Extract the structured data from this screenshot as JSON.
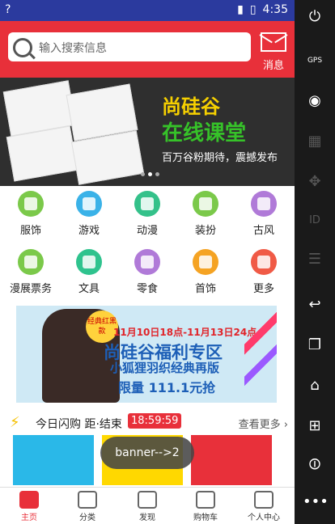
{
  "status": {
    "time": "4:35",
    "left": "?"
  },
  "search": {
    "placeholder": "输入搜索信息"
  },
  "header": {
    "msg_label": "消息"
  },
  "banner": {
    "brand": "尚硅谷",
    "title": "在线课堂",
    "subtitle": "百万谷粉期待，震撼发布"
  },
  "categories": [
    "服饰",
    "游戏",
    "动漫",
    "装扮",
    "古风",
    "漫展票务",
    "文具",
    "零食",
    "首饰",
    "更多"
  ],
  "category_colors": [
    "#7bc94a",
    "#3ab2e8",
    "#34c18a",
    "#7bc94a",
    "#b07ad8",
    "#7bc94a",
    "#2fc38e",
    "#b07ad8",
    "#f5a323",
    "#f05a46"
  ],
  "promo": {
    "badge": "经典红黑款",
    "line1": "11月10日18点-11月13日24点",
    "line2": "尚硅谷福利专区",
    "line3": "小狐狸羽织经典再版",
    "line4": "限量 111.1元抢"
  },
  "flash": {
    "title": "今日闪购 距·结束",
    "timer": "18:59:59",
    "more": "查看更多 ›"
  },
  "toast": "banner-->2",
  "nav": [
    "主页",
    "分类",
    "发现",
    "购物车",
    "个人中心"
  ],
  "colors": {
    "accent": "#e8303a",
    "statusbar": "#2b3a9e"
  }
}
